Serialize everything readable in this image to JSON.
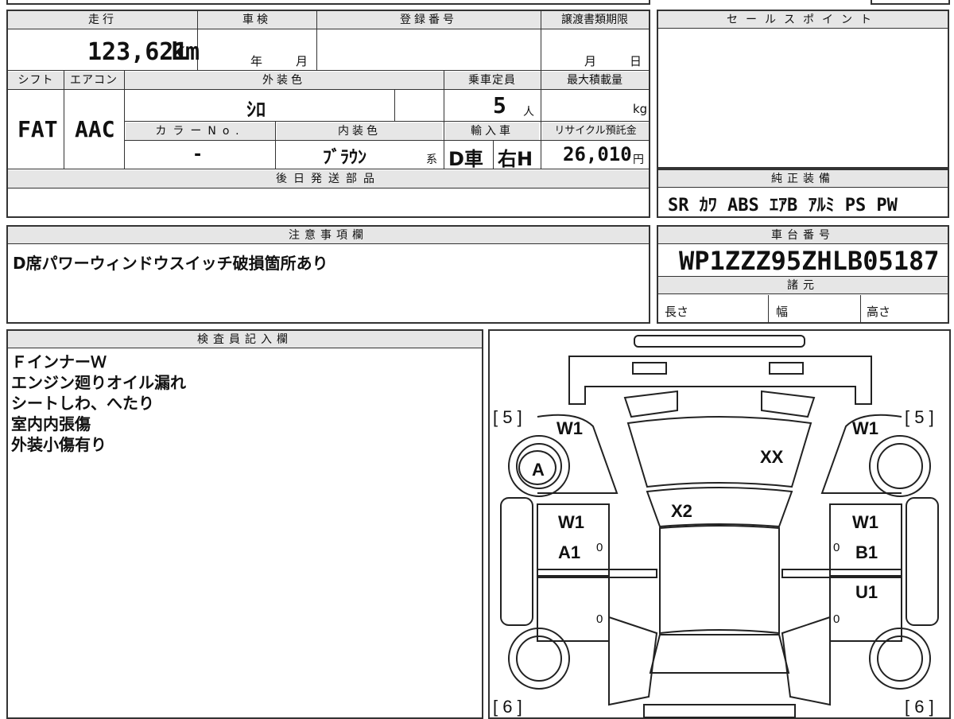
{
  "top": {
    "mileage_label": "走行",
    "mileage_value": "123,621",
    "mileage_unit": "km",
    "shaken_label": "車検",
    "shaken_year": "年",
    "shaken_month": "月",
    "reg_label": "登録番号",
    "transfer_label": "譲渡書類期限",
    "transfer_month": "月",
    "transfer_day": "日",
    "shift_label": "シフト",
    "shift_value": "FAT",
    "ac_label": "エアコン",
    "ac_value": "AAC",
    "ext_color_label": "外装色",
    "ext_color_value": "ｼﾛ",
    "capacity_label": "乗車定員",
    "capacity_value": "5",
    "capacity_unit": "人",
    "load_label": "最大積載量",
    "load_unit": "kg",
    "color_no_label": "カラーNo.",
    "color_no_value": "-",
    "int_color_label": "内装色",
    "int_color_value": "ﾌﾞﾗｳﾝ",
    "int_color_suffix": "系",
    "import_label": "輸入車",
    "import_value": "D車",
    "drive_value": "右H",
    "recycle_label": "リサイクル預託金",
    "recycle_value": "26,010",
    "recycle_unit": "円",
    "later_parts_label": "後日発送部品"
  },
  "sale_points": {
    "label": "セールスポイント"
  },
  "equipment": {
    "label": "純正装備",
    "value": "SR ｶﾜ ABS ｴｱB ｱﾙﾐ PS PW"
  },
  "notes": {
    "label": "注意事項欄",
    "text": "D席パワーウィンドウスイッチ破損箇所あり"
  },
  "chassis": {
    "label": "車台番号",
    "value": "WP1ZZZ95ZHLB05187",
    "spec_label": "諸元",
    "length": "長さ",
    "width": "幅",
    "height": "高さ"
  },
  "inspector": {
    "label": "検査員記入欄",
    "lines": [
      "ＦインナーＷ",
      "エンジン廻りオイル漏れ",
      "シートしわ、へたり",
      "室内内張傷",
      "外装小傷有り"
    ]
  },
  "diagram": {
    "tl_bracket": "[ 5 ]",
    "tr_bracket": "[ 5 ]",
    "bl_bracket": "[ 6 ]",
    "br_bracket": "[ 6 ]",
    "fl_fender": "W1",
    "fr_fender": "W1",
    "fl_wheel": "A",
    "hood": "XX",
    "windshield": "X2",
    "fl_door_1": "W1",
    "fl_door_2": "A1",
    "fr_door_1": "W1",
    "fr_door_2": "B1",
    "rr_door": "U1",
    "zero": "0"
  }
}
